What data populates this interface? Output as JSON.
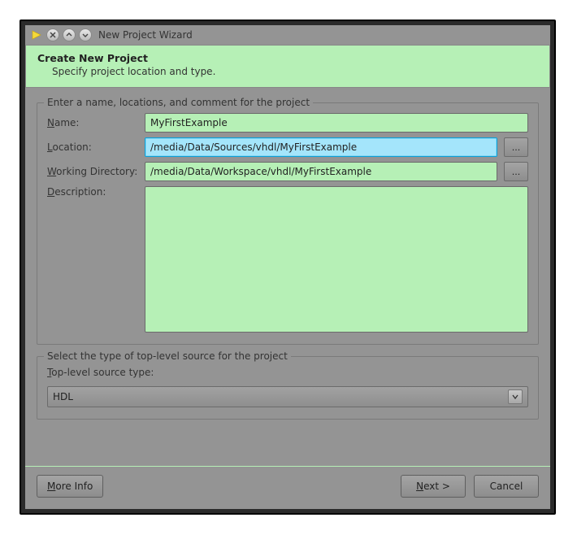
{
  "window": {
    "title": "New Project Wizard"
  },
  "header": {
    "title": "Create New Project",
    "subtitle": "Specify project location and type."
  },
  "fieldset1": {
    "legend": "Enter a name, locations, and comment for the project",
    "name_label": "Name:",
    "name_value": "MyFirstExample",
    "location_label": "Location:",
    "location_value": "/media/Data/Sources/vhdl/MyFirstExample",
    "workdir_label": "Working Directory:",
    "workdir_value": "/media/Data/Workspace/vhdl/MyFirstExample",
    "description_label": "Description:",
    "description_value": "",
    "browse_label": "..."
  },
  "fieldset2": {
    "legend": "Select the type of top-level source for the project",
    "type_label": "Top-level source type:",
    "type_value": "HDL"
  },
  "buttons": {
    "more_info": "More Info",
    "next": "Next >",
    "cancel": "Cancel"
  }
}
